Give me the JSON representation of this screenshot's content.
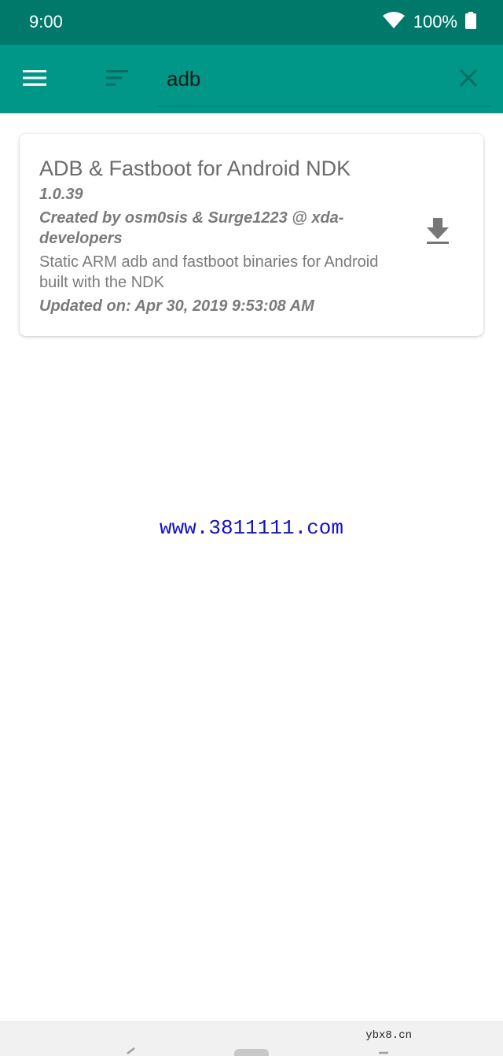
{
  "status_bar": {
    "time": "9:00",
    "battery": "100%",
    "icons": [
      "wifi-icon",
      "battery-icon"
    ]
  },
  "toolbar": {
    "icons": [
      "menu-icon",
      "sort-icon",
      "close-icon"
    ],
    "search": {
      "value": "adb",
      "placeholder": ""
    }
  },
  "results": [
    {
      "title": "ADB & Fastboot for Android NDK",
      "version": "1.0.39",
      "author": "Created by osm0sis & Surge1223 @ xda-developers",
      "description": "Static ARM adb and fastboot binaries for Android built with the NDK",
      "updated": "Updated on: Apr 30, 2019 9:53:08 AM",
      "action_icon": "download-icon"
    }
  ],
  "watermark": "www.3811111.com",
  "footer_domain": "ybx8.cn",
  "colors": {
    "status_bar": "#00796b",
    "app_bar": "#009688",
    "watermark": "#1010cc",
    "card_text": "#7a7a7a"
  }
}
